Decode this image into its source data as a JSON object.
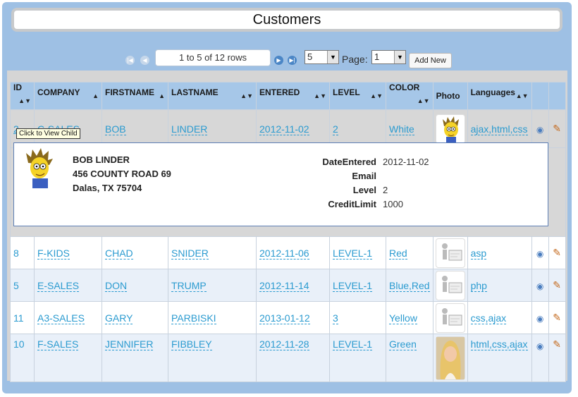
{
  "title": "Customers",
  "pager": {
    "rows_text": "1 to 5 of 12 rows",
    "page_size": "5",
    "page_label": "Page:",
    "page_number": "1",
    "add_new": "Add New",
    "first_icon": "first-page-icon",
    "prev_icon": "prev-page-icon",
    "next_icon": "next-page-icon",
    "last_icon": "last-page-icon"
  },
  "columns": [
    "ID",
    "COMPANY",
    "FIRSTNAME",
    "LASTNAME",
    "ENTERED",
    "LEVEL",
    "COLOR",
    "Photo",
    "Languages"
  ],
  "rows": [
    {
      "id": "2",
      "company": "C-SALES",
      "first": "BOB",
      "last": "LINDER",
      "entered": "2012-11-02",
      "level": "2",
      "color": "White",
      "photo": "cartoon-avatar",
      "languages": "ajax,html,css"
    },
    {
      "id": "8",
      "company": "F-KIDS",
      "first": "CHAD",
      "last": "SNIDER",
      "entered": "2012-11-06",
      "level": "LEVEL-1",
      "color": "Red",
      "photo": "placeholder",
      "languages": "asp"
    },
    {
      "id": "5",
      "company": "E-SALES",
      "first": "DON",
      "last": "TRUMP",
      "entered": "2012-11-14",
      "level": "LEVEL-1",
      "color": "Blue,Red",
      "photo": "placeholder",
      "languages": "php"
    },
    {
      "id": "11",
      "company": "A3-SALES",
      "first": "GARY",
      "last": "PARBISKI",
      "entered": "2013-01-12",
      "level": "3",
      "color": "Yellow",
      "photo": "placeholder",
      "languages": "css,ajax"
    },
    {
      "id": "10",
      "company": "F-SALES",
      "first": "JENNIFER",
      "last": "FIBBLEY",
      "entered": "2012-11-28",
      "level": "LEVEL-1",
      "color": "Green",
      "photo": "woman-photo",
      "languages": "html,css,ajax"
    }
  ],
  "tooltip": "Click to View Child",
  "detail": {
    "name": "BOB LINDER",
    "address1": "456 COUNTY ROAD 69",
    "address2": "Dalas, TX 75704",
    "fields": [
      {
        "label": "DateEntered",
        "value": "2012-11-02"
      },
      {
        "label": "Email",
        "value": ""
      },
      {
        "label": "Level",
        "value": "2"
      },
      {
        "label": "CreditLimit",
        "value": "1000"
      }
    ]
  },
  "colors": {
    "header": "#a6c7e8",
    "link": "#2b9bd0",
    "frame": "#9ec0e4"
  }
}
